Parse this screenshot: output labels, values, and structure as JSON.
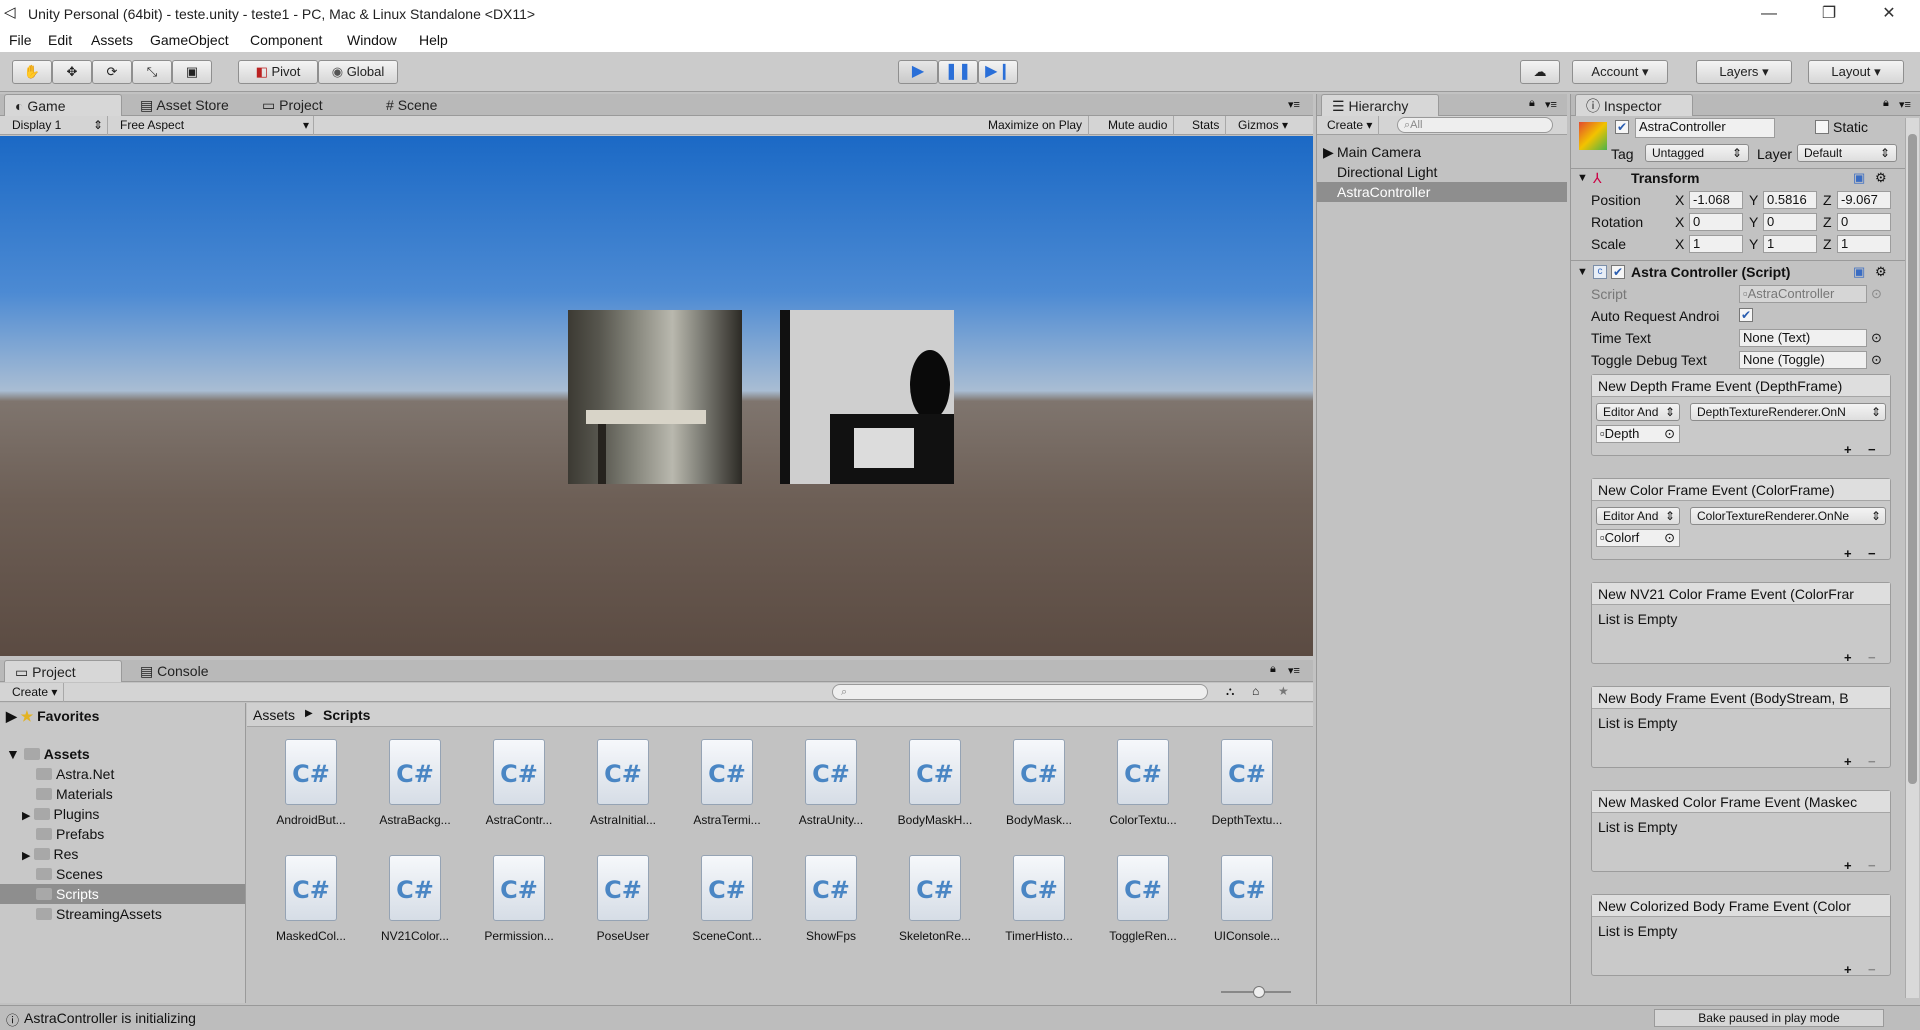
{
  "window": {
    "title": "Unity Personal (64bit) - teste.unity - teste1 - PC, Mac & Linux Standalone <DX11>",
    "minimize": "—",
    "maximize": "❐",
    "close": "✕"
  },
  "menu": [
    "File",
    "Edit",
    "Assets",
    "GameObject",
    "Component",
    "Window",
    "Help"
  ],
  "toolbar": {
    "pivot": "Pivot",
    "global": "Global",
    "play_state": "playing",
    "account": "Account",
    "layers": "Layers",
    "layout": "Layout"
  },
  "game_panel": {
    "tabs": [
      "Game",
      "Asset Store",
      "Project",
      "Scene"
    ],
    "active_tab": "Game",
    "display": "Display 1",
    "aspect": "Free Aspect",
    "maximize_on_play": "Maximize on Play",
    "mute_audio": "Mute audio",
    "stats": "Stats",
    "gizmos": "Gizmos"
  },
  "hierarchy": {
    "tab": "Hierarchy",
    "create": "Create",
    "search_placeholder": "All",
    "items": [
      "Main Camera",
      "Directional Light",
      "AstraController"
    ],
    "selected": "AstraController"
  },
  "inspector": {
    "tab": "Inspector",
    "object_name": "AstraController",
    "static": "Static",
    "tag_label": "Tag",
    "tag": "Untagged",
    "layer_label": "Layer",
    "layer": "Default",
    "transform": {
      "title": "Transform",
      "position": {
        "label": "Position",
        "x": "-1.068",
        "y": "0.5816",
        "z": "-9.067"
      },
      "rotation": {
        "label": "Rotation",
        "x": "0",
        "y": "0",
        "z": "0"
      },
      "scale": {
        "label": "Scale",
        "x": "1",
        "y": "1",
        "z": "1"
      }
    },
    "script_component": {
      "title": "Astra Controller (Script)",
      "script_label": "Script",
      "script_value": "AstraController",
      "auto_request_label": "Auto Request Androi",
      "time_text_label": "Time Text",
      "time_text_value": "None (Text)",
      "toggle_debug_label": "Toggle Debug Text",
      "toggle_debug_value": "None (Toggle)"
    },
    "events": [
      {
        "title": "New Depth Frame Event (DepthFrame)",
        "runtime": "Editor And",
        "method": "DepthTextureRenderer.OnN",
        "object": "Depth"
      },
      {
        "title": "New Color Frame Event (ColorFrame)",
        "runtime": "Editor And",
        "method": "ColorTextureRenderer.OnNe",
        "object": "Colorf"
      },
      {
        "title": "New NV21 Color Frame Event (ColorFrar",
        "empty": "List is Empty"
      },
      {
        "title": "New Body Frame Event (BodyStream, B",
        "empty": "List is Empty"
      },
      {
        "title": "New Masked Color Frame Event (Maskec",
        "empty": "List is Empty"
      },
      {
        "title": "New Colorized Body Frame Event (Color",
        "empty": "List is Empty"
      }
    ]
  },
  "project_panel": {
    "tabs": [
      "Project",
      "Console"
    ],
    "create": "Create",
    "favorites": "Favorites",
    "assets": "Assets",
    "folders": [
      "Astra.Net",
      "Materials",
      "Plugins",
      "Prefabs",
      "Res",
      "Scenes",
      "Scripts",
      "StreamingAssets"
    ],
    "selected_folder": "Scripts",
    "breadcrumb": [
      "Assets",
      "Scripts"
    ],
    "files": [
      "AndroidBut...",
      "AstraBackg...",
      "AstraContr...",
      "AstraInitial...",
      "AstraTermi...",
      "AstraUnity...",
      "BodyMaskH...",
      "BodyMask...",
      "ColorTextu...",
      "DepthTextu...",
      "MaskedCol...",
      "NV21Color...",
      "Permission...",
      "PoseUser",
      "SceneCont...",
      "ShowFps",
      "SkeletonRe...",
      "TimerHisto...",
      "ToggleRen...",
      "UIConsole..."
    ],
    "file_icon": "C#"
  },
  "status": {
    "message": "AstraController is initializing",
    "bake": "Bake paused in play mode"
  }
}
